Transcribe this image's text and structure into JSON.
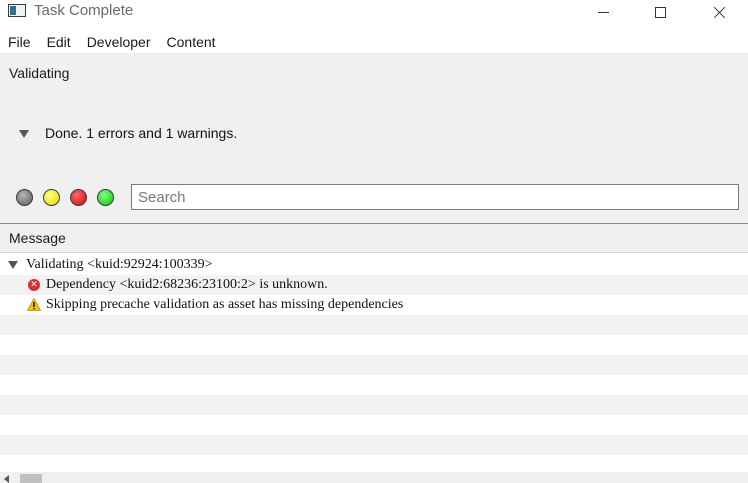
{
  "window": {
    "title": "Task Complete"
  },
  "menu": {
    "items": [
      "File",
      "Edit",
      "Developer",
      "Content"
    ]
  },
  "status": {
    "heading": "Validating",
    "summary": "Done. 1 errors and 1 warnings."
  },
  "filters": [
    {
      "name": "all",
      "color": "#6a6a6a"
    },
    {
      "name": "warnings",
      "color": "#f2e600"
    },
    {
      "name": "errors",
      "color": "#e00000"
    },
    {
      "name": "success",
      "color": "#20d020"
    }
  ],
  "search": {
    "placeholder": "Search",
    "value": ""
  },
  "messages": {
    "column_header": "Message",
    "rows": [
      {
        "type": "group",
        "text": "Validating <kuid:92924:100339>"
      },
      {
        "type": "error",
        "text": "Dependency <kuid2:68236:23100:2> is unknown."
      },
      {
        "type": "warning",
        "text": "Skipping precache validation as asset has missing dependencies"
      }
    ]
  },
  "icons": {
    "group": "triangle-down-icon",
    "error": "error-icon",
    "warning": "warning-icon"
  }
}
